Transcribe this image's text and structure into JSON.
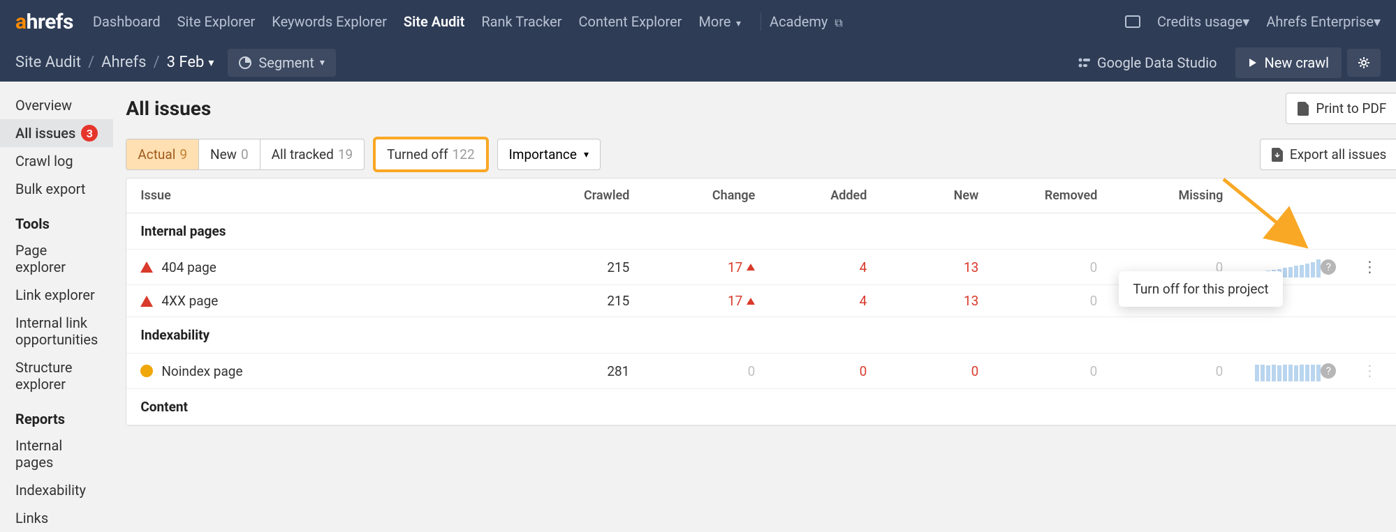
{
  "topnav": {
    "items": [
      "Dashboard",
      "Site Explorer",
      "Keywords Explorer",
      "Site Audit",
      "Rank Tracker",
      "Content Explorer",
      "More"
    ],
    "active_index": 3,
    "academy": "Academy",
    "credits": "Credits usage",
    "account": "Ahrefs Enterprise"
  },
  "subnav": {
    "crumb1": "Site Audit",
    "crumb2": "Ahrefs",
    "crumb3": "3 Feb",
    "segment": "Segment",
    "gds": "Google Data Studio",
    "new_crawl": "New crawl"
  },
  "sidebar": {
    "items": [
      {
        "label": "Overview"
      },
      {
        "label": "All issues",
        "badge": "3",
        "active": true
      },
      {
        "label": "Crawl log"
      },
      {
        "label": "Bulk export"
      }
    ],
    "tools_title": "Tools",
    "tools": [
      {
        "label": "Page explorer"
      },
      {
        "label": "Link explorer"
      },
      {
        "label": "Internal link opportunities"
      },
      {
        "label": "Structure explorer"
      }
    ],
    "reports_title": "Reports",
    "reports": [
      {
        "label": "Internal pages"
      },
      {
        "label": "Indexability"
      },
      {
        "label": "Links"
      }
    ]
  },
  "main": {
    "title": "All issues",
    "print": "Print to PDF",
    "export": "Export all issues",
    "importance": "Importance",
    "tabs": [
      {
        "label": "Actual",
        "count": "9",
        "active": true
      },
      {
        "label": "New",
        "count": "0"
      },
      {
        "label": "All tracked",
        "count": "19"
      },
      {
        "label": "Turned off",
        "count": "122",
        "highlighted": true
      }
    ],
    "columns": [
      "Issue",
      "Crawled",
      "Change",
      "Added",
      "New",
      "Removed",
      "Missing"
    ],
    "groups": [
      {
        "title": "Internal pages",
        "rows": [
          {
            "issue": "404 page",
            "icon": "warn",
            "crawled": "215",
            "change": "17",
            "change_dir": "up",
            "added": "4",
            "new": "13",
            "removed": "0",
            "missing": "0",
            "spark": [
              6,
              8,
              10,
              11,
              12,
              14,
              15,
              17,
              18,
              20,
              22,
              26
            ],
            "dots": true
          },
          {
            "issue": "4XX page",
            "icon": "warn",
            "crawled": "215",
            "change": "17",
            "change_dir": "up",
            "added": "4",
            "new": "13",
            "removed": "0",
            "missing": "",
            "spark": [],
            "dots": false
          }
        ]
      },
      {
        "title": "Indexability",
        "rows": [
          {
            "issue": "Noindex page",
            "icon": "info",
            "crawled": "281",
            "change": "0",
            "change_dir": "",
            "added": "0",
            "new": "0",
            "removed": "0",
            "missing": "0",
            "spark": [
              24,
              24,
              23,
              24,
              23,
              24,
              24,
              23,
              24,
              24,
              24,
              24
            ],
            "dots": true,
            "dim": true
          }
        ]
      },
      {
        "title": "Content",
        "rows": []
      }
    ],
    "tooltip": "Turn off for this project"
  }
}
